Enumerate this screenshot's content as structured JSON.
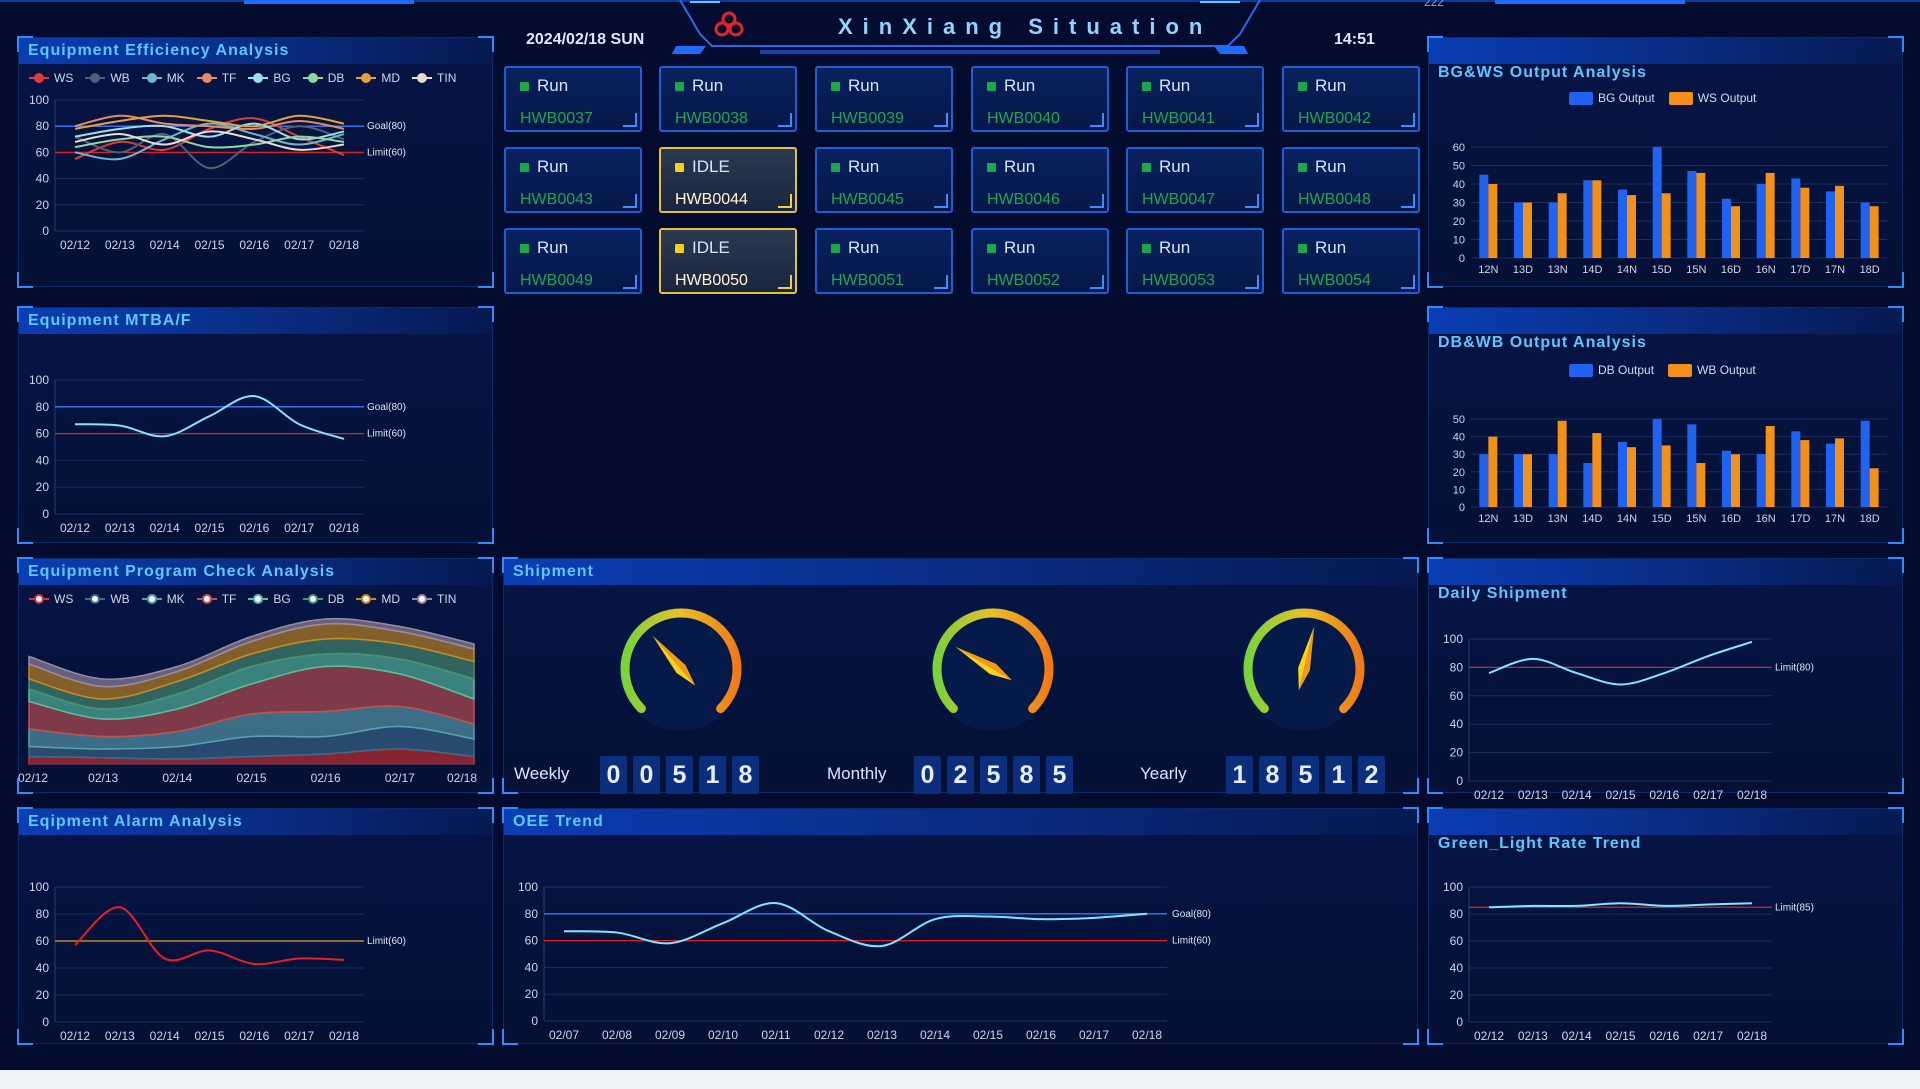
{
  "header": {
    "date": "2024/02/18 SUN",
    "title": "XinXiang Situation",
    "time": "14:51",
    "top_right_text": "222"
  },
  "colors": {
    "goal": "#3a78ff",
    "limit": "#e02020",
    "accent": "#5dc8ff"
  },
  "panels": {
    "efficiency": "Equipment Efficiency Analysis",
    "mtba": "Equipment MTBA/F",
    "program_check": "Equipment Program Check Analysis",
    "alarm": "Eqipment Alarm Analysis",
    "bgws": "BG&WS Output Analysis",
    "dbwb": "DB&WB Output Analysis",
    "shipment": "Shipment",
    "oee": "OEE Trend",
    "daily_shipment": "Daily Shipment",
    "green_light": "Green_Light Rate Trend"
  },
  "equipment": [
    {
      "status": "Run",
      "id": "HWB0037"
    },
    {
      "status": "Run",
      "id": "HWB0038"
    },
    {
      "status": "Run",
      "id": "HWB0039"
    },
    {
      "status": "Run",
      "id": "HWB0040"
    },
    {
      "status": "Run",
      "id": "HWB0041"
    },
    {
      "status": "Run",
      "id": "HWB0042"
    },
    {
      "status": "Run",
      "id": "HWB0043"
    },
    {
      "status": "IDLE",
      "id": "HWB0044"
    },
    {
      "status": "Run",
      "id": "HWB0045"
    },
    {
      "status": "Run",
      "id": "HWB0046"
    },
    {
      "status": "Run",
      "id": "HWB0047"
    },
    {
      "status": "Run",
      "id": "HWB0048"
    },
    {
      "status": "Run",
      "id": "HWB0049"
    },
    {
      "status": "IDLE",
      "id": "HWB0050"
    },
    {
      "status": "Run",
      "id": "HWB0051"
    },
    {
      "status": "Run",
      "id": "HWB0052"
    },
    {
      "status": "Run",
      "id": "HWB0053"
    },
    {
      "status": "Run",
      "id": "HWB0054"
    }
  ],
  "shipment": {
    "weekly": {
      "label": "Weekly",
      "digits": [
        "0",
        "0",
        "5",
        "1",
        "8"
      ],
      "gauge_fraction": 0.35
    },
    "monthly": {
      "label": "Monthly",
      "digits": [
        "0",
        "2",
        "5",
        "8",
        "5"
      ],
      "gauge_fraction": 0.28
    },
    "yearly": {
      "label": "Yearly",
      "digits": [
        "1",
        "8",
        "5",
        "1",
        "2"
      ],
      "gauge_fraction": 0.55
    }
  },
  "chart_data": [
    {
      "id": "efficiency",
      "type": "line",
      "x": [
        "02/12",
        "02/13",
        "02/14",
        "02/15",
        "02/16",
        "02/17",
        "02/18"
      ],
      "ylim": [
        0,
        100
      ],
      "yticks": [
        0,
        20,
        40,
        60,
        80,
        100
      ],
      "ref_lines": [
        {
          "label": "Goal(80)",
          "value": 80,
          "color": "#3a78ff"
        },
        {
          "label": "Limit(60)",
          "value": 60,
          "color": "#e02020"
        }
      ],
      "series": [
        {
          "name": "WS",
          "color": "#e03b3b",
          "values": [
            55,
            68,
            62,
            78,
            86,
            72,
            58
          ]
        },
        {
          "name": "WB",
          "color": "#4f5f73",
          "values": [
            72,
            60,
            74,
            48,
            68,
            80,
            70
          ]
        },
        {
          "name": "MK",
          "color": "#6fb7c9",
          "values": [
            60,
            55,
            70,
            82,
            74,
            66,
            74
          ]
        },
        {
          "name": "TF",
          "color": "#e88a5c",
          "values": [
            80,
            88,
            82,
            80,
            78,
            84,
            78
          ]
        },
        {
          "name": "BG",
          "color": "#9fe0e8",
          "values": [
            72,
            78,
            80,
            72,
            82,
            70,
            76
          ]
        },
        {
          "name": "DB",
          "color": "#8fd6a0",
          "values": [
            64,
            70,
            72,
            64,
            66,
            72,
            68
          ]
        },
        {
          "name": "MD",
          "color": "#e4a23a",
          "values": [
            78,
            84,
            88,
            84,
            80,
            88,
            82
          ]
        },
        {
          "name": "TIN",
          "color": "#e8dcd0",
          "values": [
            68,
            74,
            66,
            76,
            70,
            62,
            66
          ]
        }
      ]
    },
    {
      "id": "mtba",
      "type": "line",
      "x": [
        "02/12",
        "02/13",
        "02/14",
        "02/15",
        "02/16",
        "02/17",
        "02/18"
      ],
      "ylim": [
        0,
        100
      ],
      "yticks": [
        0,
        20,
        40,
        60,
        80,
        100
      ],
      "ref_lines": [
        {
          "label": "Goal(80)",
          "value": 80,
          "color": "#3a78ff"
        },
        {
          "label": "Limit(60)",
          "value": 60,
          "color": "#e02020"
        }
      ],
      "series": [
        {
          "color": "#7fe6ff",
          "values": [
            67,
            66,
            58,
            73,
            88,
            67,
            56
          ]
        }
      ]
    },
    {
      "id": "program_check",
      "type": "area",
      "x": [
        "02/12",
        "02/13",
        "02/14",
        "02/15",
        "02/16",
        "02/17",
        "02/18"
      ],
      "series": [
        {
          "name": "WS",
          "color": "#d03030",
          "values": [
            6,
            5,
            4,
            6,
            8,
            12,
            6
          ]
        },
        {
          "name": "WB",
          "color": "#3a6a8c",
          "values": [
            8,
            7,
            10,
            16,
            14,
            18,
            14
          ]
        },
        {
          "name": "MK",
          "color": "#5aa0b0",
          "values": [
            14,
            10,
            12,
            18,
            20,
            16,
            12
          ]
        },
        {
          "name": "TF",
          "color": "#c05050",
          "values": [
            22,
            14,
            18,
            24,
            36,
            26,
            20
          ]
        },
        {
          "name": "BG",
          "color": "#58c0a0",
          "values": [
            10,
            8,
            12,
            14,
            10,
            12,
            16
          ]
        },
        {
          "name": "DB",
          "color": "#4a9070",
          "values": [
            8,
            8,
            10,
            10,
            12,
            12,
            14
          ]
        },
        {
          "name": "MD",
          "color": "#c88a20",
          "values": [
            12,
            10,
            8,
            10,
            12,
            10,
            10
          ]
        },
        {
          "name": "TIN",
          "color": "#9a8aa0",
          "values": [
            6,
            6,
            4,
            4,
            4,
            4,
            4
          ]
        }
      ]
    },
    {
      "id": "alarm",
      "type": "line",
      "x": [
        "02/12",
        "02/13",
        "02/14",
        "02/15",
        "02/16",
        "02/17",
        "02/18"
      ],
      "ylim": [
        0,
        100
      ],
      "yticks": [
        0,
        20,
        40,
        60,
        80,
        100
      ],
      "ref_lines": [
        {
          "label": "Limit(60)",
          "value": 60,
          "color": "#e8a020"
        }
      ],
      "series": [
        {
          "color": "#e82020",
          "values": [
            57,
            85,
            47,
            53,
            43,
            47,
            46
          ]
        }
      ]
    },
    {
      "id": "bgws",
      "type": "bar",
      "categories": [
        "12N",
        "13D",
        "13N",
        "14D",
        "14N",
        "15D",
        "15N",
        "16D",
        "16N",
        "17D",
        "17N",
        "18D"
      ],
      "ylim": [
        0,
        60
      ],
      "yticks": [
        0,
        10,
        20,
        30,
        40,
        50,
        60
      ],
      "series": [
        {
          "name": "BG Output",
          "color": "#1f63f0",
          "values": [
            45,
            30,
            30,
            42,
            37,
            60,
            47,
            32,
            40,
            43,
            36,
            30
          ]
        },
        {
          "name": "WS Output",
          "color": "#f3901a",
          "values": [
            40,
            30,
            35,
            42,
            34,
            35,
            46,
            28,
            46,
            38,
            39,
            28
          ]
        }
      ]
    },
    {
      "id": "dbwb",
      "type": "bar",
      "categories": [
        "12N",
        "13D",
        "13N",
        "14D",
        "14N",
        "15D",
        "15N",
        "16D",
        "16N",
        "17D",
        "17N",
        "18D"
      ],
      "ylim": [
        0,
        50
      ],
      "yticks": [
        0,
        10,
        20,
        30,
        40,
        50
      ],
      "series": [
        {
          "name": "DB Output",
          "color": "#1f63f0",
          "values": [
            30,
            30,
            30,
            25,
            37,
            50,
            47,
            32,
            30,
            43,
            36,
            49
          ]
        },
        {
          "name": "WB Output",
          "color": "#f3901a",
          "values": [
            40,
            30,
            49,
            42,
            34,
            35,
            25,
            30,
            46,
            38,
            39,
            22
          ]
        }
      ]
    },
    {
      "id": "oee",
      "type": "line",
      "x": [
        "02/07",
        "02/08",
        "02/09",
        "02/10",
        "02/11",
        "02/12",
        "02/13",
        "02/14",
        "02/15",
        "02/16",
        "02/17",
        "02/18"
      ],
      "ylim": [
        0,
        100
      ],
      "yticks": [
        0,
        20,
        40,
        60,
        80,
        100
      ],
      "ref_lines": [
        {
          "label": "Goal(80)",
          "value": 80,
          "color": "#3a78ff"
        },
        {
          "label": "Limit(60)",
          "value": 60,
          "color": "#e02020"
        }
      ],
      "series": [
        {
          "color": "#7fe6ff",
          "values": [
            67,
            66,
            58,
            73,
            88,
            67,
            56,
            76,
            78,
            76,
            77,
            80
          ]
        }
      ]
    },
    {
      "id": "daily_shipment",
      "type": "line",
      "x": [
        "02/12",
        "02/13",
        "02/14",
        "02/15",
        "02/16",
        "02/17",
        "02/18"
      ],
      "ylim": [
        0,
        100
      ],
      "yticks": [
        0,
        20,
        40,
        60,
        80,
        100
      ],
      "ref_lines": [
        {
          "label": "Limit(80)",
          "value": 80,
          "color": "#e02020"
        }
      ],
      "series": [
        {
          "color": "#7fe6ff",
          "values": [
            76,
            86,
            76,
            68,
            76,
            88,
            98
          ]
        }
      ]
    },
    {
      "id": "green_light",
      "type": "line",
      "x": [
        "02/12",
        "02/13",
        "02/14",
        "02/15",
        "02/16",
        "02/17",
        "02/18"
      ],
      "ylim": [
        0,
        100
      ],
      "yticks": [
        0,
        20,
        40,
        60,
        80,
        100
      ],
      "ref_lines": [
        {
          "label": "Limit(85)",
          "value": 85,
          "color": "#e02020"
        }
      ],
      "series": [
        {
          "color": "#7fe6ff",
          "values": [
            85,
            86,
            86,
            88,
            86,
            87,
            88
          ]
        }
      ]
    }
  ]
}
